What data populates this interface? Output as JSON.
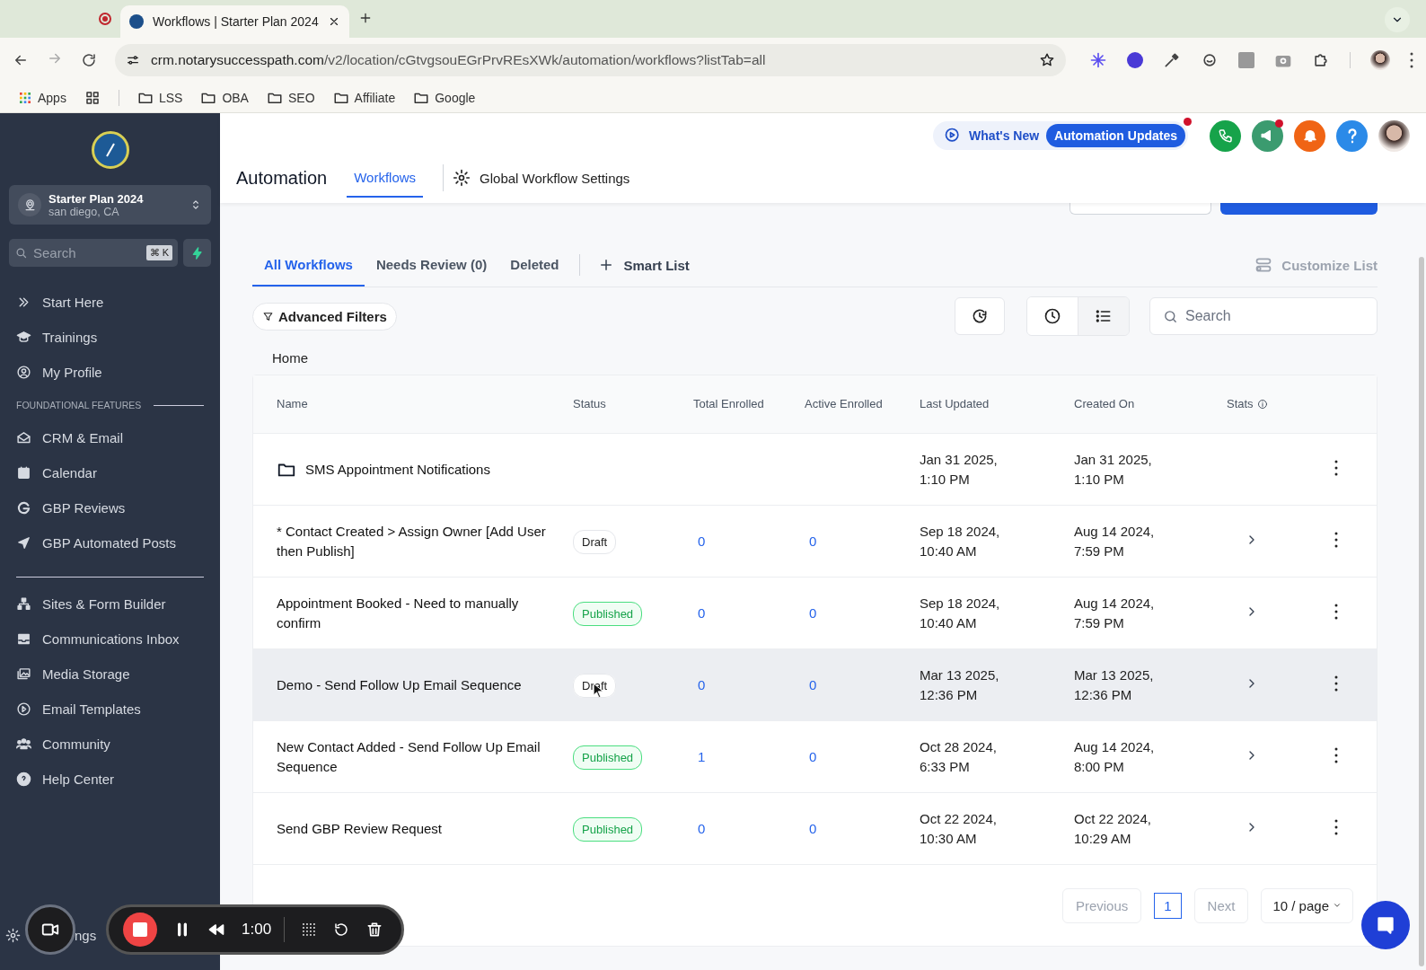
{
  "browser": {
    "tabs": [
      {
        "title": "Workflows | Starter Plan 2024",
        "selected": true
      }
    ],
    "url_host": "crm.notarysuccesspath.com",
    "url_path": "/v2/location/cGtvgsouEGrPrvREsXWk/automation/workflows?listTab=all",
    "bookmarks": [
      {
        "label": "Apps",
        "kind": "apps"
      },
      {
        "label": "LSS",
        "kind": "folder"
      },
      {
        "label": "OBA",
        "kind": "folder"
      },
      {
        "label": "SEO",
        "kind": "folder"
      },
      {
        "label": "Affiliate",
        "kind": "folder"
      },
      {
        "label": "Google",
        "kind": "folder"
      }
    ]
  },
  "sidebar": {
    "account": {
      "name": "Starter Plan 2024",
      "location": "san diego, CA"
    },
    "search": {
      "placeholder": "Search",
      "shortcut": "⌘ K"
    },
    "groups": [
      {
        "items": [
          "Start Here",
          "Trainings",
          "My Profile"
        ]
      },
      {
        "label": "FOUNDATIONAL FEATURES",
        "items": [
          "CRM & Email",
          "Calendar",
          "GBP Reviews",
          "GBP Automated Posts"
        ]
      },
      {
        "items": [
          "Sites & Form Builder",
          "Communications Inbox",
          "Media Storage",
          "Email Templates",
          "Community",
          "Help Center"
        ]
      }
    ],
    "bottom_item": "ngs"
  },
  "header": {
    "whats_new": "What's New",
    "updates_badge": "Automation Updates",
    "title": "Automation",
    "nav": [
      {
        "label": "Workflows",
        "selected": true
      }
    ],
    "settings_link": "Global Workflow Settings"
  },
  "list_tabs": [
    {
      "label": "All Workflows",
      "selected": true
    },
    {
      "label": "Needs Review (0)",
      "selected": false
    },
    {
      "label": "Deleted",
      "selected": false
    }
  ],
  "smart_list": "Smart List",
  "customize": "Customize List",
  "filters": "Advanced Filters",
  "view_toggle": [
    {
      "kind": "clock",
      "selected": false
    },
    {
      "kind": "list",
      "selected": true
    }
  ],
  "search": {
    "placeholder": "Search"
  },
  "breadcrumb": "Home",
  "table": {
    "columns": [
      "Name",
      "Status",
      "Total Enrolled",
      "Active Enrolled",
      "Last Updated",
      "Created On",
      "Stats"
    ],
    "rows": [
      {
        "kind": "folder",
        "name": "SMS Appointment Notifications",
        "last_updated": "Jan 31 2025, 1:10 PM",
        "created_on": "Jan 31 2025, 1:10 PM",
        "highlighted": false
      },
      {
        "kind": "workflow",
        "name": "* Contact Created > Assign Owner [Add User then Publish]",
        "status": "Draft",
        "total": "0",
        "active": "0",
        "last_updated": "Sep 18 2024, 10:40 AM",
        "created_on": "Aug 14 2024, 7:59 PM",
        "highlighted": false
      },
      {
        "kind": "workflow",
        "name": "Appointment Booked - Need to manually confirm",
        "status": "Published",
        "total": "0",
        "active": "0",
        "last_updated": "Sep 18 2024, 10:40 AM",
        "created_on": "Aug 14 2024, 7:59 PM",
        "highlighted": false
      },
      {
        "kind": "workflow",
        "name": "Demo - Send Follow Up Email Sequence",
        "status": "Draft",
        "total": "0",
        "active": "0",
        "last_updated": "Mar 13 2025, 12:36 PM",
        "created_on": "Mar 13 2025, 12:36 PM",
        "highlighted": true
      },
      {
        "kind": "workflow",
        "name": "New Contact Added - Send Follow Up Email Sequence",
        "status": "Published",
        "total": "1",
        "active": "0",
        "last_updated": "Oct 28 2024, 6:33 PM",
        "created_on": "Aug 14 2024, 8:00 PM",
        "highlighted": false
      },
      {
        "kind": "workflow",
        "name": "Send GBP Review Request",
        "status": "Published",
        "total": "0",
        "active": "0",
        "last_updated": "Oct 22 2024, 10:30 AM",
        "created_on": "Oct 22 2024, 10:29 AM",
        "highlighted": false
      }
    ]
  },
  "pagination": {
    "previous": "Previous",
    "pages": [
      {
        "label": "1",
        "selected": true
      }
    ],
    "next": "Next",
    "page_size": "10 / page"
  },
  "recorder": {
    "time": "1:00"
  }
}
